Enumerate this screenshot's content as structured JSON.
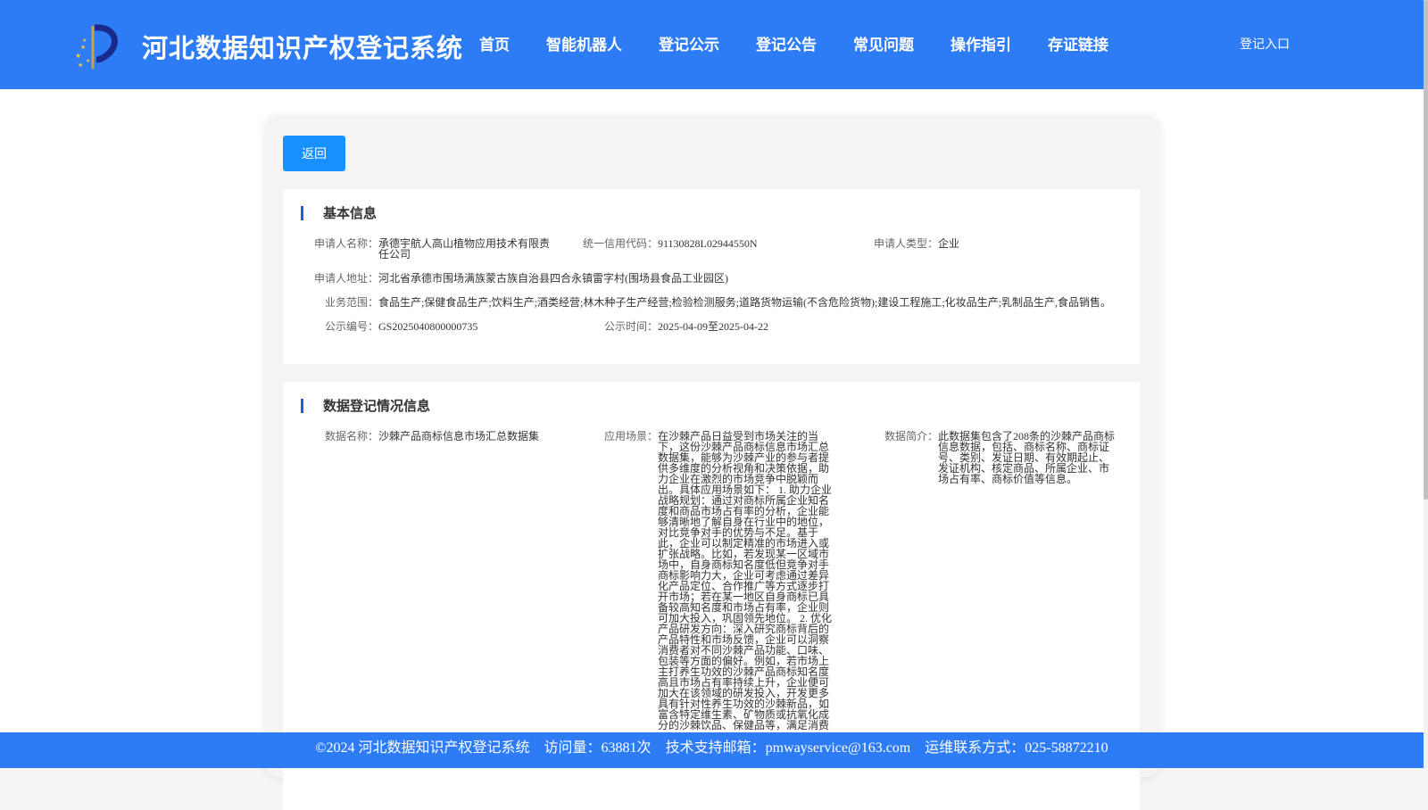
{
  "header": {
    "site_title": "河北数据知识产权登记系统",
    "nav": [
      "首页",
      "智能机器人",
      "登记公示",
      "登记公告",
      "常见问题",
      "操作指引",
      "存证链接"
    ],
    "login": "登记入口",
    "logo_icon": "hebei-ip-logo-icon",
    "color": "#2d7cf6"
  },
  "back_button": "返回",
  "basic_info": {
    "title": "基本信息",
    "applicant_name_label": "申请人名称：",
    "applicant_name": "承德宇航人高山植物应用技术有限责任公司",
    "credit_code_label": "统一信用代码：",
    "credit_code": "91130828L02944550N",
    "applicant_type_label": "申请人类型：",
    "applicant_type": "企业",
    "address_label": "申请人地址：",
    "address": "河北省承德市围场满族蒙古族自治县四合永镇雷字村(围场县食品工业园区)",
    "scope_label": "业务范围：",
    "scope": "食品生产;保健食品生产;饮料生产;酒类经营;林木种子生产经营;检验检测服务;道路货物运输(不含危险货物);建设工程施工;化妆品生产;乳制品生产,食品销售。",
    "notice_no_label": "公示编号：",
    "notice_no": "GS2025040800000735",
    "notice_time_label": "公示时间：",
    "notice_time": "2025-04-09至2025-04-22"
  },
  "data_info": {
    "title": "数据登记情况信息",
    "data_name_label": "数据名称：",
    "data_name": "沙棘产品商标信息市场汇总数据集",
    "scenario_label": "应用场景：",
    "scenario": "在沙棘产品日益受到市场关注的当下，这份沙棘产品商标信息市场汇总数据集，能够为沙棘产业的参与者提供多维度的分析视角和决策依据，助力企业在激烈的市场竞争中脱颖而出。具体应用场景如下： 1. 助力企业战略规划：通过对商标所属企业知名度和商品市场占有率的分析，企业能够清晰地了解自身在行业中的地位，对比竞争对手的优势与不足。基于此，企业可以制定精准的市场进入或扩张战略。比如，若发现某一区域市场中，自身商标知名度低但竞争对手商标影响力大，企业可考虑通过差异化产品定位、合作推广等方式逐步打开市场；若在某一地区自身商标已具备较高知名度和市场占有率，企业则可加大投入，巩固领先地位。 2. 优化产品研发方向：深入研究商标背后的产品特性和市场反馈，企业可以洞察消费者对不同沙棘产品功能、口味、包装等方面的偏好。例如，若市场上主打养生功效的沙棘产品商标知名度高且市场占有率持续上升，企业便可加大在该领域的研发投入，开发更多具有针对性养生功效的沙棘新品，如富含特定维生素、矿物质或抗氧化成分的沙棘饮品、保健品等，满足消费",
    "intro_label": "数据简介：",
    "intro": "此数据集包含了208条的沙棘产品商标信息数据，包括、商标名称、商标证号、类别、发证日期、有效期起止、发证机构、核定商品、所属企业、市场占有率、商标价值等信息。"
  },
  "footer": {
    "copyright": "©2024 河北数据知识产权登记系统",
    "visits": "访问量：63881次",
    "support": "技术支持邮箱：pmwayservice@163.com",
    "contact": "运维联系方式：025-58872210"
  }
}
